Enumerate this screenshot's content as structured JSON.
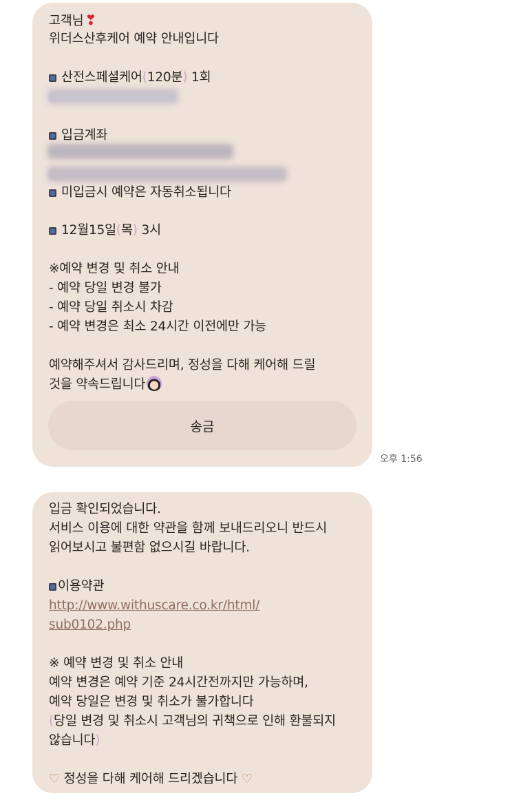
{
  "message1": {
    "greeting": "고객님",
    "intro": "위더스산후케어 예약 안내입니다",
    "service_prefix": "산전스페셜케어",
    "service_paren": "120분",
    "service_suffix": "1회",
    "deposit_label": "입금계좌",
    "cancel_notice": "미입금시 예약은 자동취소됩니다",
    "date_prefix": "12월15일",
    "date_paren": "목",
    "date_suffix": "3시",
    "policy_title": "※예약 변경 및 취소 안내",
    "policy_items": [
      "- 예약 당일 변경 불가",
      "- 예약 당일 취소시 차감",
      "- 예약 변경은 최소 24시간 이전에만 가능"
    ],
    "closing_line1": "예약해주셔서 감사드리며, 정성을 다해 케어해 드릴",
    "closing_line2": "것을 약속드립니다",
    "send_button": "송금",
    "timestamp": "오후 1:56"
  },
  "message2": {
    "line1": "입금 확인되었습니다.",
    "line2": "서비스 이용에 대한 약관을 함께 보내드리오니 반드시",
    "line3": "읽어보시고 불편함 없으시길 바랍니다.",
    "terms_label": "이용약관",
    "terms_url_line1": "http://www.withuscare.co.kr/html/",
    "terms_url_line2": "sub0102.php",
    "policy_title": "※ 예약 변경 및 취소 안내",
    "policy_line1": "예약 변경은 예약 기준 24시간전까지만 가능하며,",
    "policy_line2": "예약 당일은 변경 및 취소가 불가합니다",
    "policy_line3": "당일 변경 및 취소시 고객님의 귀책으로 인해 환불되지",
    "policy_line4": "않습니다",
    "closing": "정성을 다해 케어해 드리겠습니다"
  }
}
